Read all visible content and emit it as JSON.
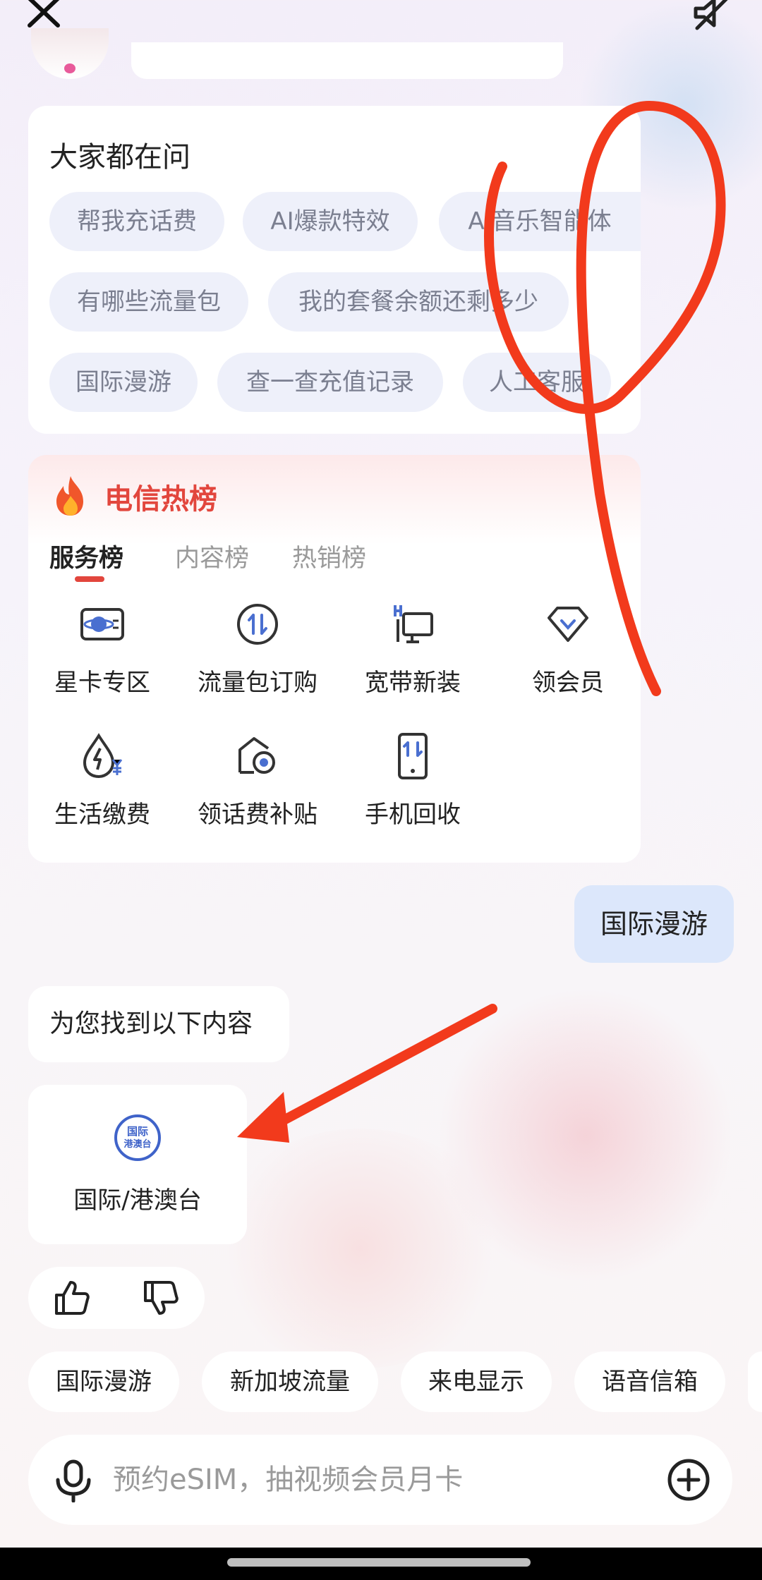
{
  "colors": {
    "accent_red": "#e2463d",
    "chip_bg": "#eef0fa",
    "user_bubble": "#dce7fb",
    "icon_blue": "#4a6fd0",
    "annotation": "#f23a1c"
  },
  "top": {
    "close_icon": "close-icon",
    "mute_icon": "speaker-muted-icon"
  },
  "ask": {
    "title": "大家都在问",
    "chips": [
      "帮我充话费",
      "AI爆款特效",
      "AI音乐智能体",
      "有哪些流量包",
      "我的套餐余额还剩多少",
      "国际漫游",
      "查一查充值记录",
      "人工客服"
    ]
  },
  "hot": {
    "title": "电信热榜",
    "tabs": [
      "服务榜",
      "内容榜",
      "热销榜"
    ],
    "services": [
      {
        "label": "星卡专区",
        "icon": "planet-card-icon"
      },
      {
        "label": "流量包订购",
        "icon": "data-arrows-icon"
      },
      {
        "label": "宽带新装",
        "icon": "broadband-icon"
      },
      {
        "label": "领会员",
        "icon": "diamond-icon"
      },
      {
        "label": "生活缴费",
        "icon": "utility-bill-icon"
      },
      {
        "label": "领话费补贴",
        "icon": "subsidy-icon"
      },
      {
        "label": "手机回收",
        "icon": "phone-recycle-icon"
      }
    ]
  },
  "chat": {
    "user_message": "国际漫游",
    "bot_message": "为您找到以下内容",
    "result": {
      "label": "国际/港澳台",
      "icon_text_1": "国际",
      "icon_text_2": "港澳台"
    }
  },
  "suggestions": [
    "国际漫游",
    "新加坡流量",
    "来电显示",
    "语音信箱"
  ],
  "input": {
    "placeholder": "预约eSIM，抽视频会员月卡"
  }
}
